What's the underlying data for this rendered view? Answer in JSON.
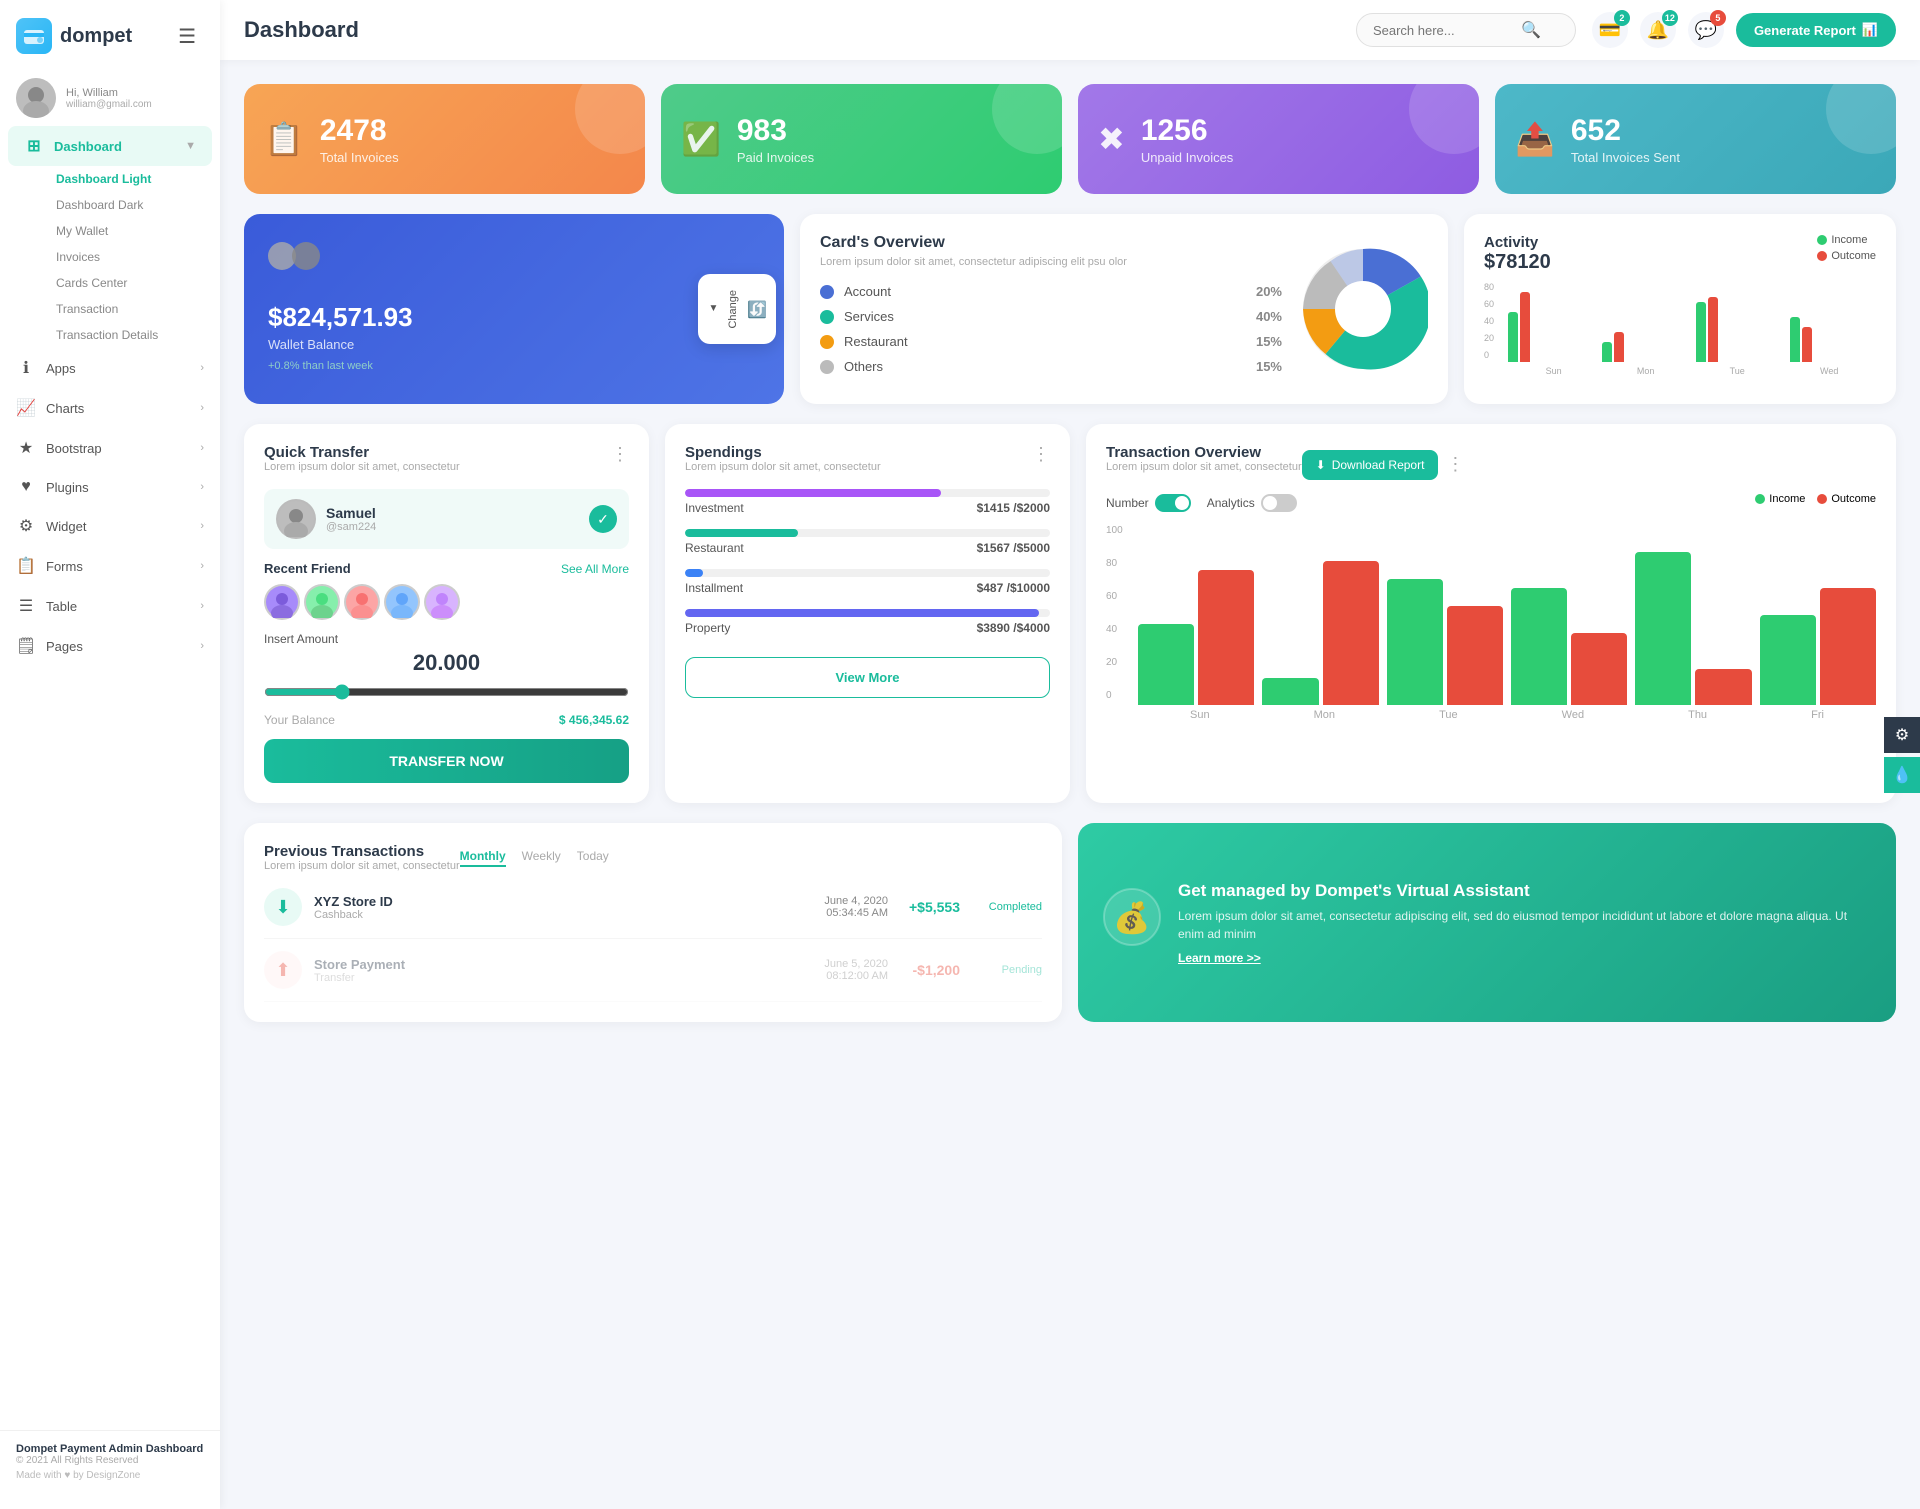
{
  "sidebar": {
    "logo": "dompet",
    "logo_icon": "💳",
    "user": {
      "greeting": "Hi, William",
      "name": "William",
      "email": "william@gmail.com"
    },
    "nav": [
      {
        "id": "dashboard",
        "label": "Dashboard",
        "icon": "⊞",
        "active": true,
        "has_arrow": true,
        "children": [
          "Dashboard Light",
          "Dashboard Dark",
          "My Wallet",
          "Invoices",
          "Cards Center",
          "Transaction",
          "Transaction Details"
        ]
      },
      {
        "id": "apps",
        "label": "Apps",
        "icon": "ℹ",
        "has_arrow": true
      },
      {
        "id": "charts",
        "label": "Charts",
        "icon": "📈",
        "has_arrow": true
      },
      {
        "id": "bootstrap",
        "label": "Bootstrap",
        "icon": "★",
        "has_arrow": true
      },
      {
        "id": "plugins",
        "label": "Plugins",
        "icon": "♥",
        "has_arrow": true
      },
      {
        "id": "widget",
        "label": "Widget",
        "icon": "⚙",
        "has_arrow": true
      },
      {
        "id": "forms",
        "label": "Forms",
        "icon": "📋",
        "has_arrow": true
      },
      {
        "id": "table",
        "label": "Table",
        "icon": "☰",
        "has_arrow": true
      },
      {
        "id": "pages",
        "label": "Pages",
        "icon": "🗒",
        "has_arrow": true
      }
    ],
    "footer": {
      "title": "Dompet Payment Admin Dashboard",
      "copy": "© 2021 All Rights Reserved",
      "made": "Made with ♥ by DesignZone"
    }
  },
  "topbar": {
    "title": "Dashboard",
    "search_placeholder": "Search here...",
    "icons": {
      "wallet": {
        "badge": "2"
      },
      "bell": {
        "badge": "12"
      },
      "chat": {
        "badge": "5"
      }
    },
    "generate_btn": "Generate Report"
  },
  "stat_cards": [
    {
      "id": "total-invoices",
      "value": "2478",
      "label": "Total Invoices",
      "color": "orange",
      "icon": "📋"
    },
    {
      "id": "paid-invoices",
      "value": "983",
      "label": "Paid Invoices",
      "color": "green",
      "icon": "✅"
    },
    {
      "id": "unpaid-invoices",
      "value": "1256",
      "label": "Unpaid Invoices",
      "color": "purple",
      "icon": "✖"
    },
    {
      "id": "total-sent",
      "value": "652",
      "label": "Total Invoices Sent",
      "color": "teal",
      "icon": "📤"
    }
  ],
  "wallet": {
    "amount": "$824,571.93",
    "label": "Wallet Balance",
    "change": "+0.8% than last week",
    "change_btn": "Change"
  },
  "card_overview": {
    "title": "Card's Overview",
    "subtitle": "Lorem ipsum dolor sit amet, consectetur adipiscing elit psu olor",
    "items": [
      {
        "label": "Account",
        "pct": "20%",
        "color": "#4a6fd4"
      },
      {
        "label": "Services",
        "pct": "40%",
        "color": "#1abc9c"
      },
      {
        "label": "Restaurant",
        "pct": "15%",
        "color": "#f39c12"
      },
      {
        "label": "Others",
        "pct": "15%",
        "color": "#bbb"
      }
    ]
  },
  "activity": {
    "title": "Activity",
    "amount": "$78120",
    "income_label": "Income",
    "outcome_label": "Outcome",
    "income_color": "#2ecc71",
    "outcome_color": "#e74c3c",
    "bars": [
      {
        "day": "Sun",
        "income": 50,
        "outcome": 70
      },
      {
        "day": "Mon",
        "income": 20,
        "outcome": 30
      },
      {
        "day": "Tue",
        "income": 60,
        "outcome": 65
      },
      {
        "day": "Wed",
        "income": 45,
        "outcome": 35
      }
    ]
  },
  "quick_transfer": {
    "title": "Quick Transfer",
    "subtitle": "Lorem ipsum dolor sit amet, consectetur",
    "user": {
      "name": "Samuel",
      "handle": "@sam224",
      "avatar": "👤"
    },
    "recent_label": "Recent Friend",
    "see_all": "See All More",
    "friends": [
      "👩",
      "👨",
      "👩",
      "👨",
      "👩"
    ],
    "insert_amount_label": "Insert Amount",
    "amount": "20.000",
    "balance_label": "Your Balance",
    "balance_value": "$ 456,345.62",
    "transfer_btn": "TRANSFER NOW"
  },
  "spendings": {
    "title": "Spendings",
    "subtitle": "Lorem ipsum dolor sit amet, consectetur",
    "items": [
      {
        "label": "Investment",
        "amount": "$1415",
        "max": "$2000",
        "pct": 70,
        "color": "#a855f7"
      },
      {
        "label": "Restaurant",
        "amount": "$1567",
        "max": "$5000",
        "pct": 31,
        "color": "#1abc9c"
      },
      {
        "label": "Installment",
        "amount": "$487",
        "max": "$10000",
        "pct": 5,
        "color": "#3b82f6"
      },
      {
        "label": "Property",
        "amount": "$3890",
        "max": "$4000",
        "pct": 97,
        "color": "#6366f1"
      }
    ],
    "view_more": "View More"
  },
  "tx_overview": {
    "title": "Transaction Overview",
    "subtitle": "Lorem ipsum dolor sit amet, consectetur",
    "download_btn": "Download Report",
    "toggle1_label": "Number",
    "toggle2_label": "Analytics",
    "income_label": "Income",
    "outcome_label": "Outcome",
    "income_color": "#2ecc71",
    "outcome_color": "#e74c3c",
    "bars": [
      {
        "day": "Sun",
        "income": 45,
        "outcome": 75
      },
      {
        "day": "Mon",
        "income": 15,
        "outcome": 80
      },
      {
        "day": "Tue",
        "income": 70,
        "outcome": 55
      },
      {
        "day": "Wed",
        "income": 65,
        "outcome": 40
      },
      {
        "day": "Thu",
        "income": 85,
        "outcome": 20
      },
      {
        "day": "Fri",
        "income": 50,
        "outcome": 65
      }
    ],
    "y_labels": [
      "100",
      "80",
      "60",
      "40",
      "20",
      "0"
    ]
  },
  "prev_transactions": {
    "title": "Previous Transactions",
    "subtitle": "Lorem ipsum dolor sit amet, consectetur",
    "tabs": [
      "Monthly",
      "Weekly",
      "Today"
    ],
    "active_tab": "Monthly",
    "items": [
      {
        "name": "XYZ Store ID",
        "type": "Cashback",
        "date": "June 4, 2020",
        "time": "05:34:45 AM",
        "amount": "+$5,553",
        "status": "Completed",
        "icon": "⬇"
      }
    ]
  },
  "va_card": {
    "title": "Get managed by Dompet's Virtual Assistant",
    "desc": "Lorem ipsum dolor sit amet, consectetur adipiscing elit, sed do eiusmod tempor incididunt ut labore et dolore magna aliqua. Ut enim ad minim",
    "link": "Learn more >>"
  },
  "floating": {
    "settings_icon": "⚙",
    "water_icon": "💧"
  }
}
